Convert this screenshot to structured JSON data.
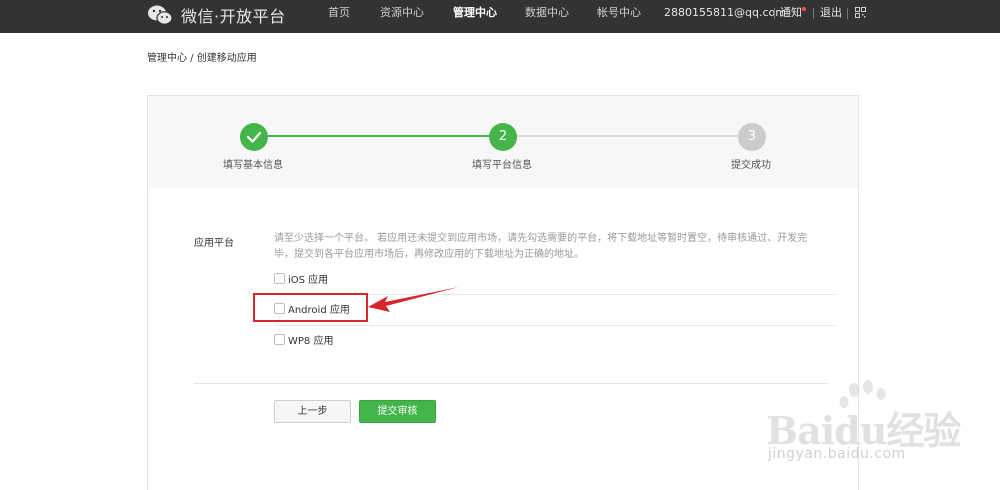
{
  "header": {
    "brand": "微信·开放平台",
    "nav": [
      {
        "label": "首页",
        "active": false
      },
      {
        "label": "资源中心",
        "active": false
      },
      {
        "label": "管理中心",
        "active": true
      },
      {
        "label": "数据中心",
        "active": false
      },
      {
        "label": "帐号中心",
        "active": false
      }
    ],
    "email": "2880155811@qq.com",
    "notify": "通知",
    "logout": "退出",
    "icons": {
      "logo": "wechat-logo-icon",
      "qr": "qr-code-icon"
    }
  },
  "breadcrumb": "管理中心 / 创建移动应用",
  "steps": [
    {
      "number": "1",
      "label": "填写基本信息",
      "state": "done"
    },
    {
      "number": "2",
      "label": "填写平台信息",
      "state": "current"
    },
    {
      "number": "3",
      "label": "提交成功",
      "state": "pending"
    }
  ],
  "form": {
    "field_label": "应用平台",
    "hint": "请至少选择一个平台。 若应用还未提交到应用市场，请先勾选需要的平台，将下载地址等暂时置空，待审核通过、开发完毕，提交到各平台应用市场后，再修改应用的下载地址为正确的地址。",
    "options": [
      {
        "label": "iOS 应用",
        "checked": false
      },
      {
        "label": "Android 应用",
        "checked": false
      },
      {
        "label": "WP8 应用",
        "checked": false
      }
    ]
  },
  "buttons": {
    "prev": "上一步",
    "submit": "提交审核"
  },
  "watermark": {
    "brand": "Baidu经验",
    "site": "jingyan.baidu.com"
  },
  "colors": {
    "accent": "#44b549",
    "topbar": "#333333",
    "annotation": "#d6262b",
    "pending": "#cccccc"
  }
}
